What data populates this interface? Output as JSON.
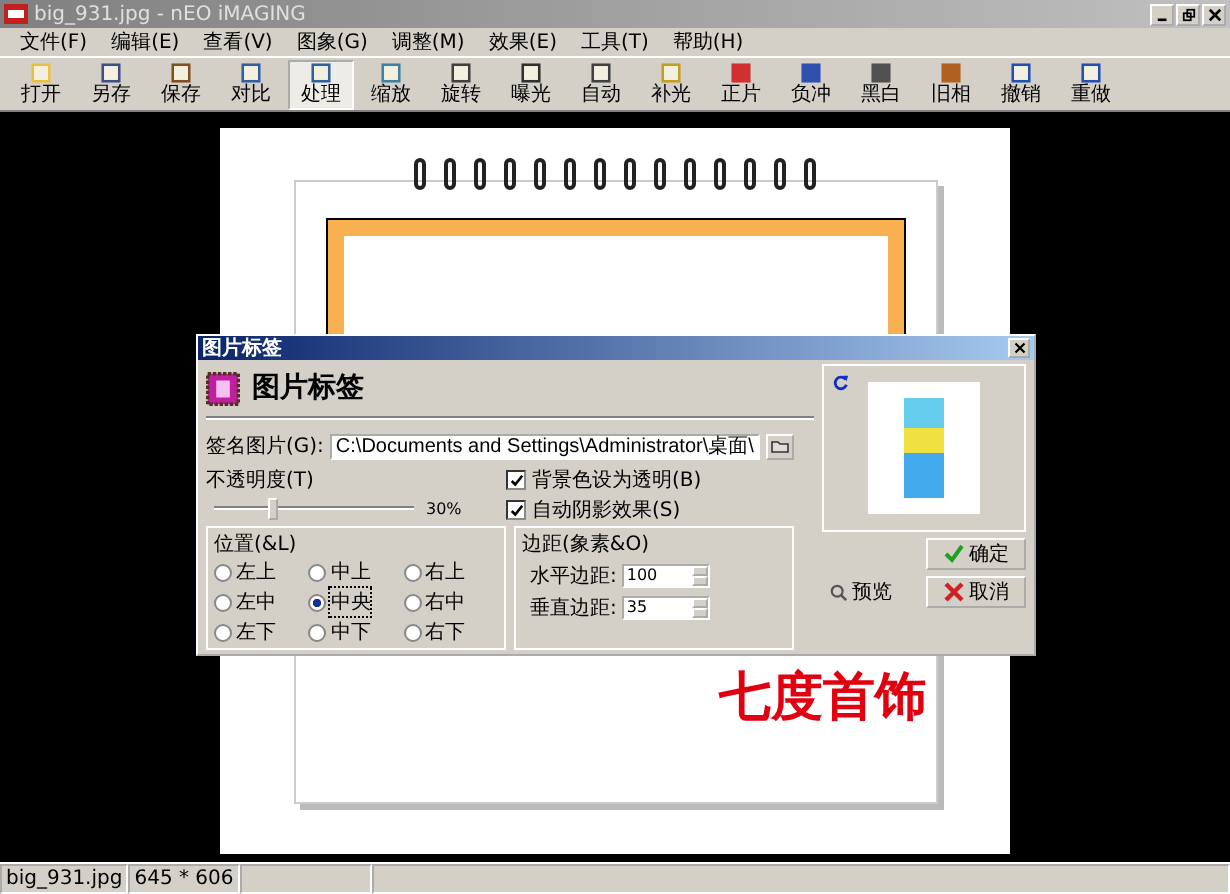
{
  "window": {
    "title": "big_931.jpg - nEO iMAGING"
  },
  "menu": [
    "文件(F)",
    "编辑(E)",
    "查看(V)",
    "图象(G)",
    "调整(M)",
    "效果(E)",
    "工具(T)",
    "帮助(H)"
  ],
  "toolbar": [
    {
      "label": "打开",
      "selected": false
    },
    {
      "label": "另存",
      "selected": false
    },
    {
      "label": "保存",
      "selected": false
    },
    {
      "label": "对比",
      "selected": false
    },
    {
      "label": "处理",
      "selected": true
    },
    {
      "label": "缩放",
      "selected": false
    },
    {
      "label": "旋转",
      "selected": false
    },
    {
      "label": "曝光",
      "selected": false
    },
    {
      "label": "自动",
      "selected": false
    },
    {
      "label": "补光",
      "selected": false
    },
    {
      "label": "正片",
      "selected": false
    },
    {
      "label": "负冲",
      "selected": false
    },
    {
      "label": "黑白",
      "selected": false
    },
    {
      "label": "旧相",
      "selected": false
    },
    {
      "label": "撤销",
      "selected": false
    },
    {
      "label": "重做",
      "selected": false
    }
  ],
  "canvas": {
    "caption": "七度首饰"
  },
  "dialog": {
    "title": "图片标签",
    "heading": "图片标签",
    "signature": {
      "label": "签名图片(G):",
      "value": "C:\\Documents and Settings\\Administrator\\桌面\\"
    },
    "opacity": {
      "label": "不透明度(T)",
      "level": 0.3,
      "reading": "30%"
    },
    "checkboxes": [
      {
        "label": "背景色设为透明(B)",
        "checked": true
      },
      {
        "label": "自动阴影效果(S)",
        "checked": true
      }
    ],
    "position": {
      "title": "位置(&L)",
      "options": [
        {
          "label": "左上",
          "selected": false
        },
        {
          "label": "中上",
          "selected": false
        },
        {
          "label": "右上",
          "selected": false
        },
        {
          "label": "左中",
          "selected": false
        },
        {
          "label": "中央",
          "selected": true
        },
        {
          "label": "右中",
          "selected": false
        },
        {
          "label": "左下",
          "selected": false
        },
        {
          "label": "中下",
          "selected": false
        },
        {
          "label": "右下",
          "selected": false
        }
      ]
    },
    "margins": {
      "title": "边距(象素&O)",
      "fields": [
        {
          "label": "水平边距:",
          "value": "100"
        },
        {
          "label": "垂直边距:",
          "value": "35"
        }
      ]
    },
    "buttons": {
      "ok": "确定",
      "preview": "预览",
      "cancel": "取消"
    }
  },
  "status_bar": [
    "big_931.jpg",
    "645 * 606"
  ]
}
